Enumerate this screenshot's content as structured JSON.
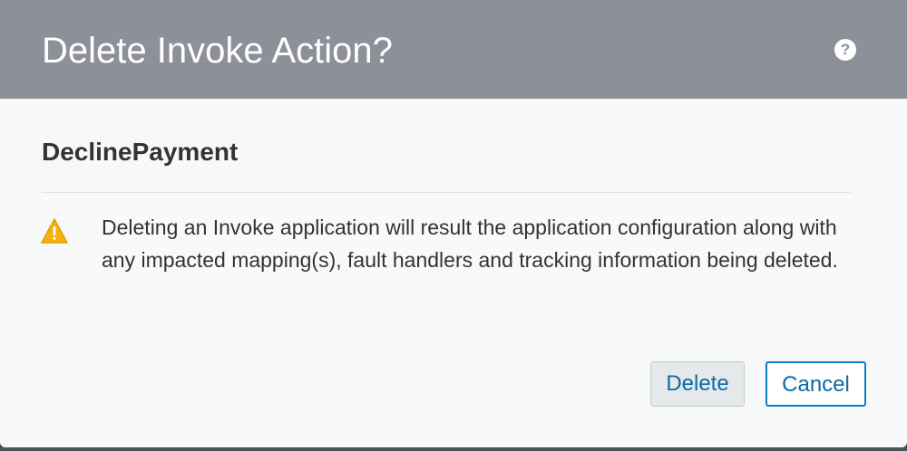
{
  "dialog": {
    "title": "Delete Invoke Action?",
    "help_icon": "question-circle-icon",
    "help_glyph": "?",
    "subject": "DeclinePayment",
    "warning_icon": "warning-triangle-icon",
    "message": "Deleting an Invoke application will result the application configuration along with any impacted mapping(s), fault handlers and tracking information being deleted.",
    "buttons": {
      "delete_label": "Delete",
      "cancel_label": "Cancel"
    }
  },
  "colors": {
    "header_bg": "#8e9099",
    "accent": "#0a7fc2",
    "warning": "#f5b20f"
  }
}
